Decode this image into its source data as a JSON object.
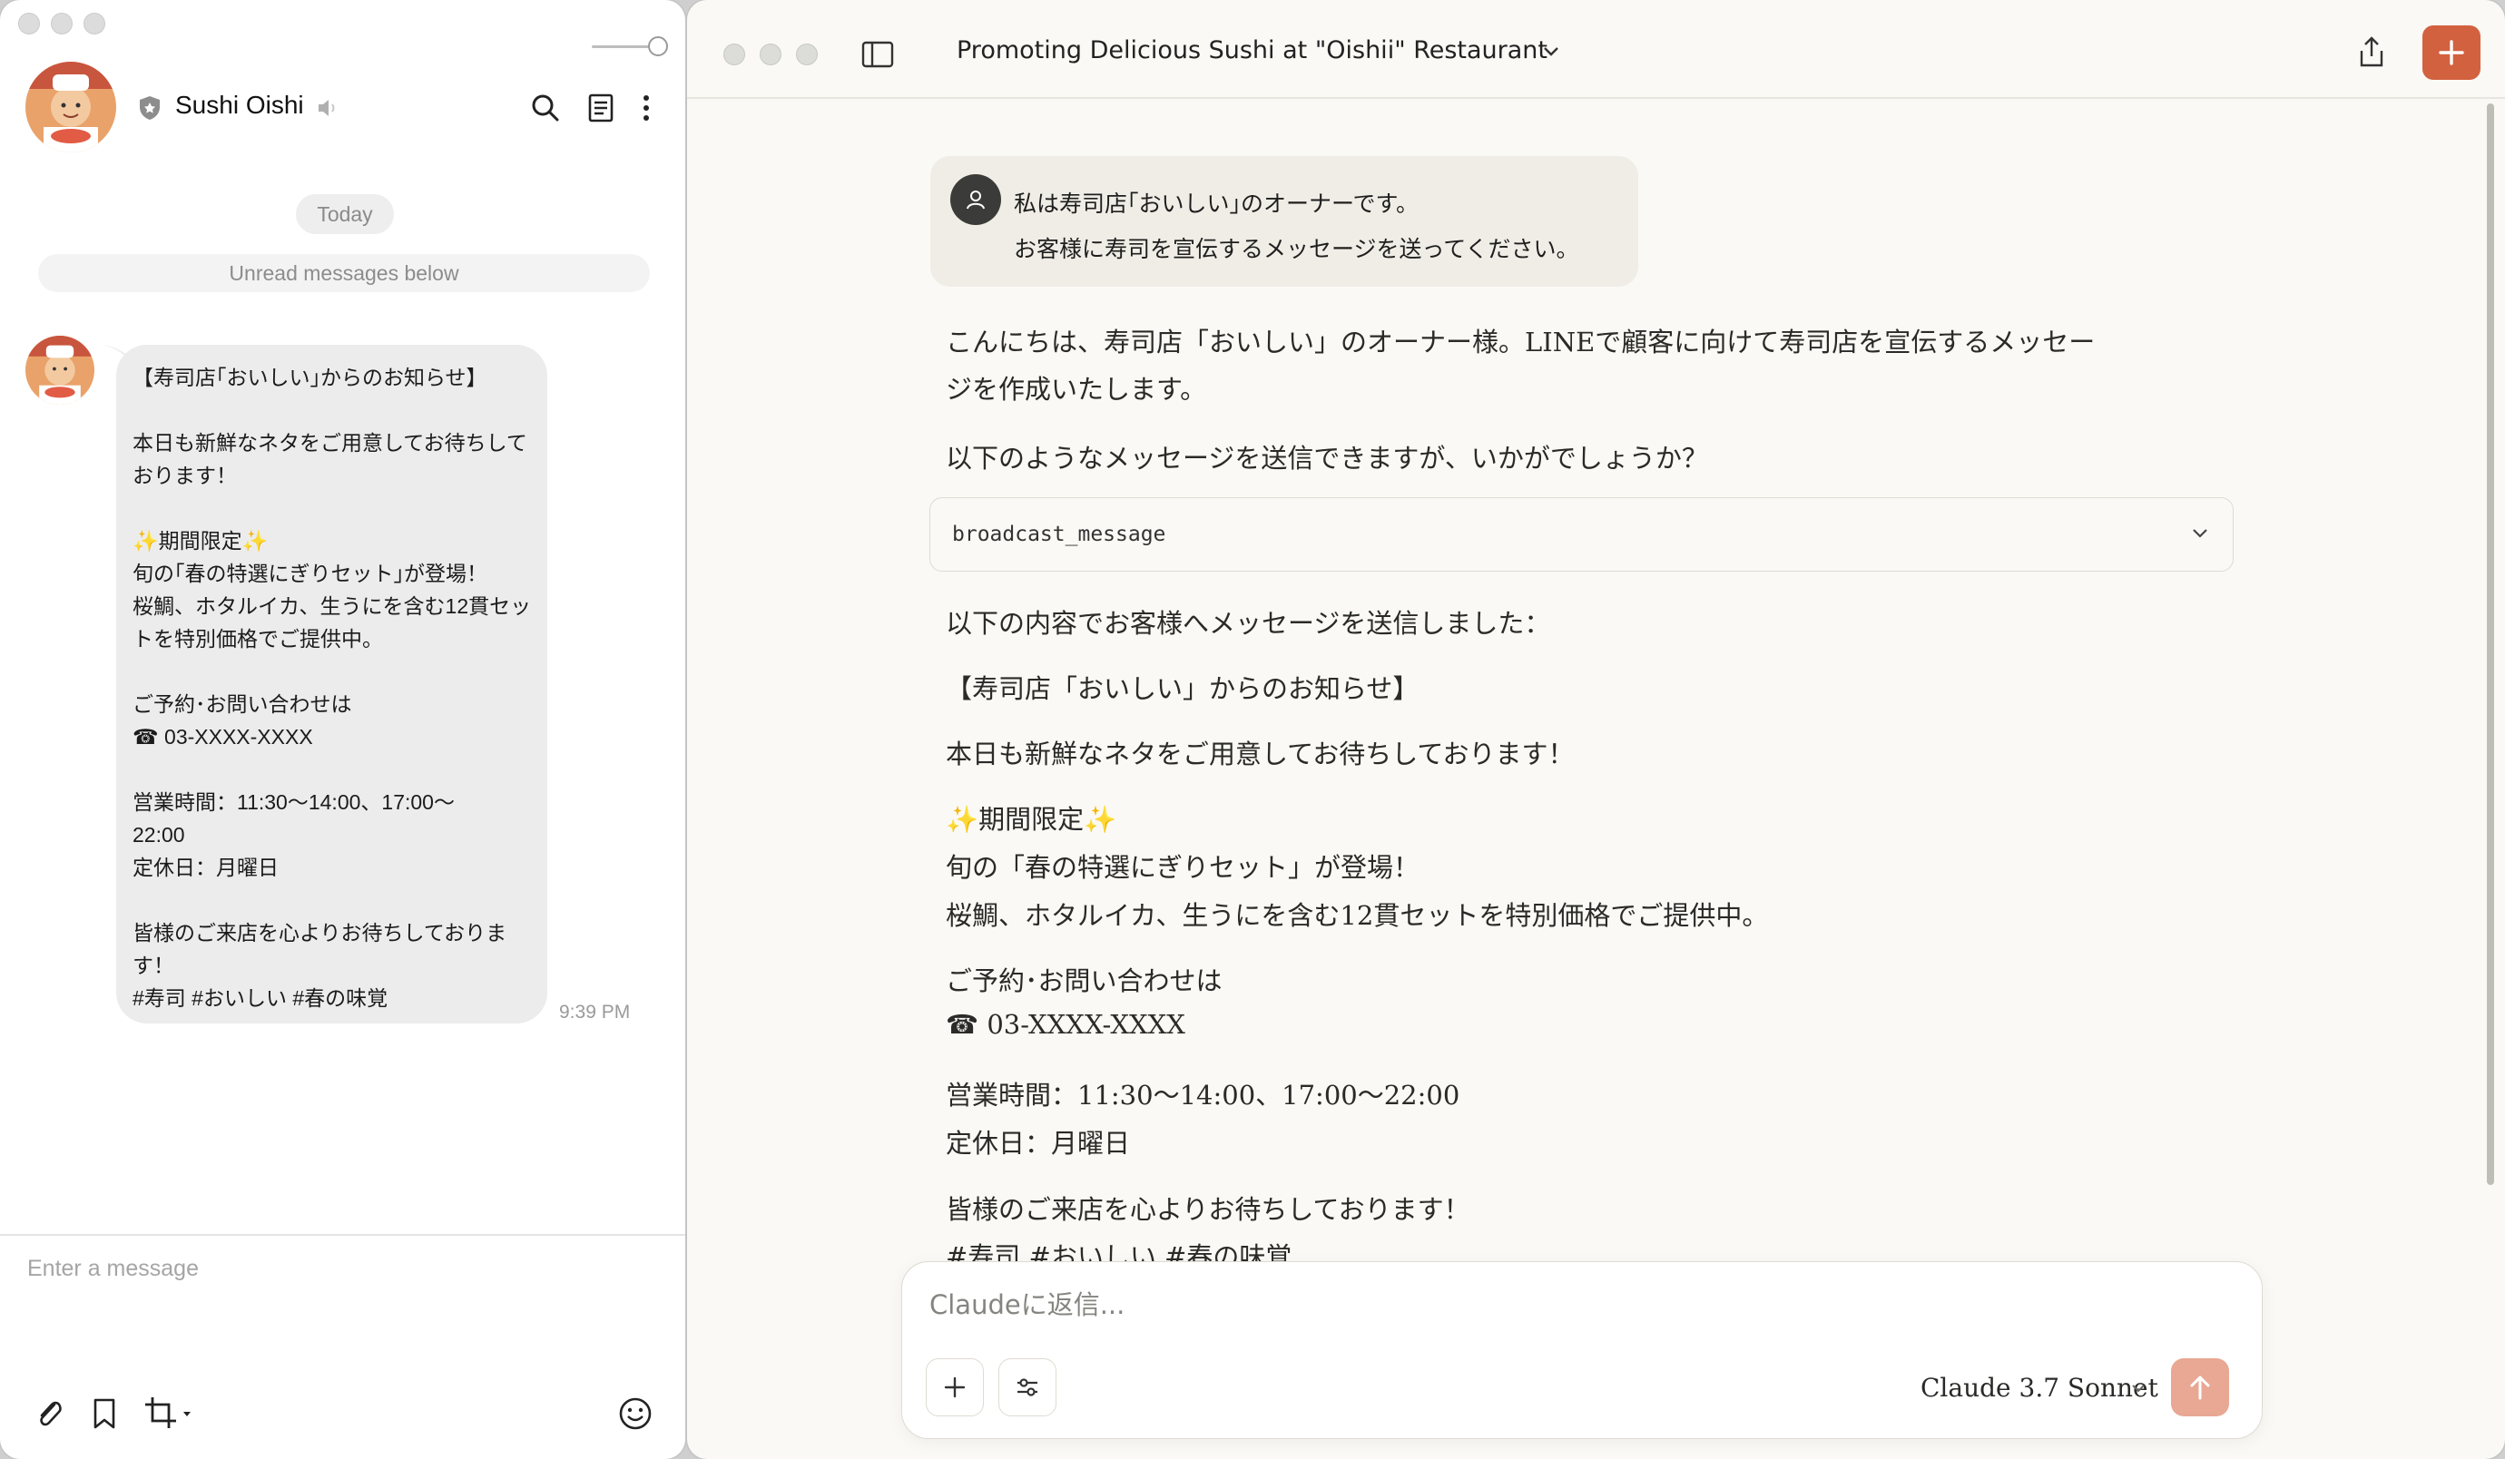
{
  "line": {
    "contact_name": "Sushi Oishi",
    "date_pill": "Today",
    "unread_banner": "Unread messages below",
    "message_lines": [
      "【寿司店｢おいしい｣からのお知らせ】",
      "",
      "本日も新鮮なネタをご用意してお待ちして",
      "おります！",
      "",
      "✨期間限定✨",
      "旬の｢春の特選にぎりセット｣が登場！",
      "桜鯛、ホタルイカ、生うにを含む12貫セッ",
      "トを特別価格でご提供中。",
      "",
      "ご予約･お問い合わせは",
      "☎ 03-XXXX-XXXX",
      "",
      "営業時間：11:30～14:00、17:00～",
      "22:00",
      "定休日：月曜日",
      "",
      "皆様のご来店を心よりお待ちしておりま",
      "す！",
      "#寿司 #おいしい #春の味覚"
    ],
    "message_time": "9:39 PM",
    "input_placeholder": "Enter a message"
  },
  "claude": {
    "title": "Promoting Delicious Sushi at \"Oishii\" Restaurant",
    "user_message": {
      "line1": "私は寿司店｢おいしい｣のオーナーです。",
      "line2": "お客様に寿司を宣伝するメッセージを送ってください。"
    },
    "reply_intro_1": "こんにちは、寿司店「おいしい」のオーナー様。LINEで顧客に向けて寿司店を宣伝するメッセー",
    "reply_intro_2": "ジを作成いたします。",
    "reply_intro_3": "以下のようなメッセージを送信できますが、いかがでしょうか？",
    "tool_name": "broadcast_message",
    "sent_heading": "以下の内容でお客様へメッセージを送信しました：",
    "sent_title": "【寿司店「おいしい」からのお知らせ】",
    "sent_line1": "本日も新鮮なネタをご用意してお待ちしております！",
    "sent_line2": "✨期間限定✨",
    "sent_line3": "旬の「春の特選にぎりセット」が登場！",
    "sent_line4": "桜鯛、ホタルイカ、生うにを含む12貫セットを特別価格でご提供中。",
    "sent_line5": "ご予約･お問い合わせは",
    "sent_line6": "☎ 03-XXXX-XXXX",
    "sent_line7": "営業時間：11:30～14:00、17:00～22:00",
    "sent_line8": "定休日：月曜日",
    "sent_line9": "皆様のご来店を心よりお待ちしております！",
    "sent_line10": "#寿司 #おいしい #春の味覚",
    "composer_placeholder": "Claudeに返信...",
    "model_name": "Claude 3.7 Sonnet"
  },
  "colors": {
    "accent": "#d2613f",
    "send_disabled": "#e8a894",
    "claude_bg": "#faf9f5",
    "line_bubble": "#ececec"
  },
  "icons": [
    "shield-icon",
    "speaker-mute-icon",
    "search-icon",
    "notes-icon",
    "more-vertical-icon",
    "paperclip-icon",
    "bookmark-icon",
    "crop-icon",
    "emoji-icon",
    "sidebar-toggle-icon",
    "chevron-down-icon",
    "share-icon",
    "plus-icon",
    "user-icon",
    "sliders-icon",
    "arrow-up-icon"
  ]
}
